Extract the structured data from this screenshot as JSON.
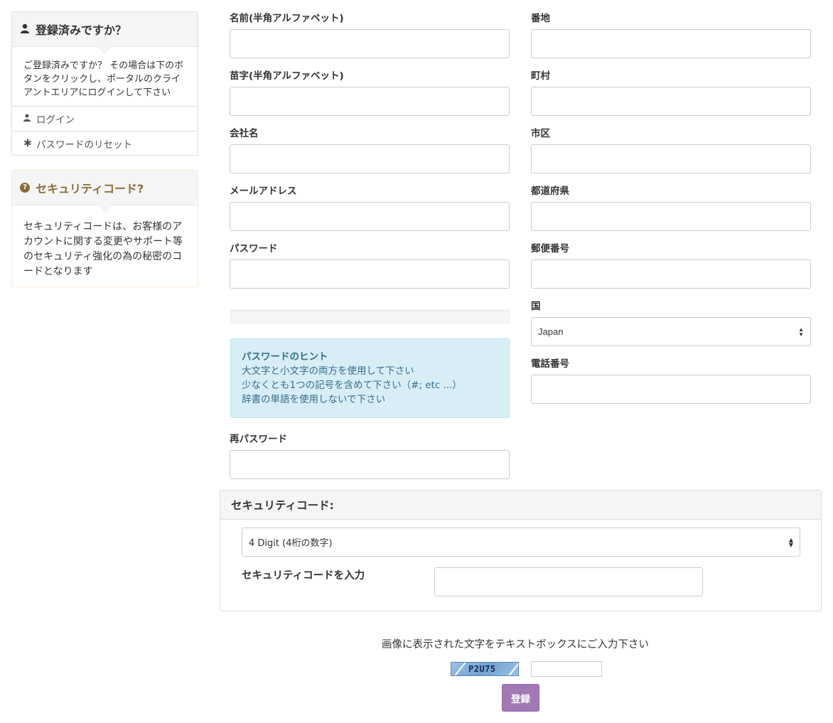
{
  "sidebar": {
    "registered_panel": {
      "title": "登録済みですか？",
      "body": "ご登録済みですか？ その場合は下のボタンをクリックし、ポータルのクライアントエリアにログインして下さい",
      "items": [
        {
          "icon": "user-icon",
          "label": "ログイン"
        },
        {
          "icon": "asterisk-icon",
          "label": "パスワードのリセット"
        }
      ]
    },
    "security_panel": {
      "title": "セキュリティコード?",
      "body": "セキュリティコードは、お客様のアカウントに関する変更やサポート等のセキュリティ強化の為の秘密のコードとなります"
    }
  },
  "form": {
    "left": {
      "first_name_label": "名前(半角アルファベット)",
      "last_name_label": "苗字(半角アルファベット)",
      "company_label": "会社名",
      "email_label": "メールアドレス",
      "password_label": "パスワード",
      "confirm_password_label": "再パスワード"
    },
    "right": {
      "address_label": "番地",
      "town_label": "町村",
      "city_label": "市区",
      "state_label": "都道府県",
      "postcode_label": "郵便番号",
      "country_label": "国",
      "country_value": "Japan",
      "phone_label": "電話番号"
    },
    "password_hint": {
      "title": "パスワードのヒント",
      "lines": [
        "大文字と小文字の両方を使用して下さい",
        "少なくとも1つの記号を含めて下さい（#; etc ...）",
        "辞書の単語を使用しないで下さい"
      ]
    }
  },
  "security_code": {
    "title": "セキュリティコード:",
    "select_value": "4 Digit (4桁の数字)",
    "input_label": "セキュリティコードを入力"
  },
  "captcha": {
    "instruction": "画像に表示された文字をテキストボックスにご入力下さい",
    "image_text": "P2U75",
    "submit_label": "登録"
  }
}
